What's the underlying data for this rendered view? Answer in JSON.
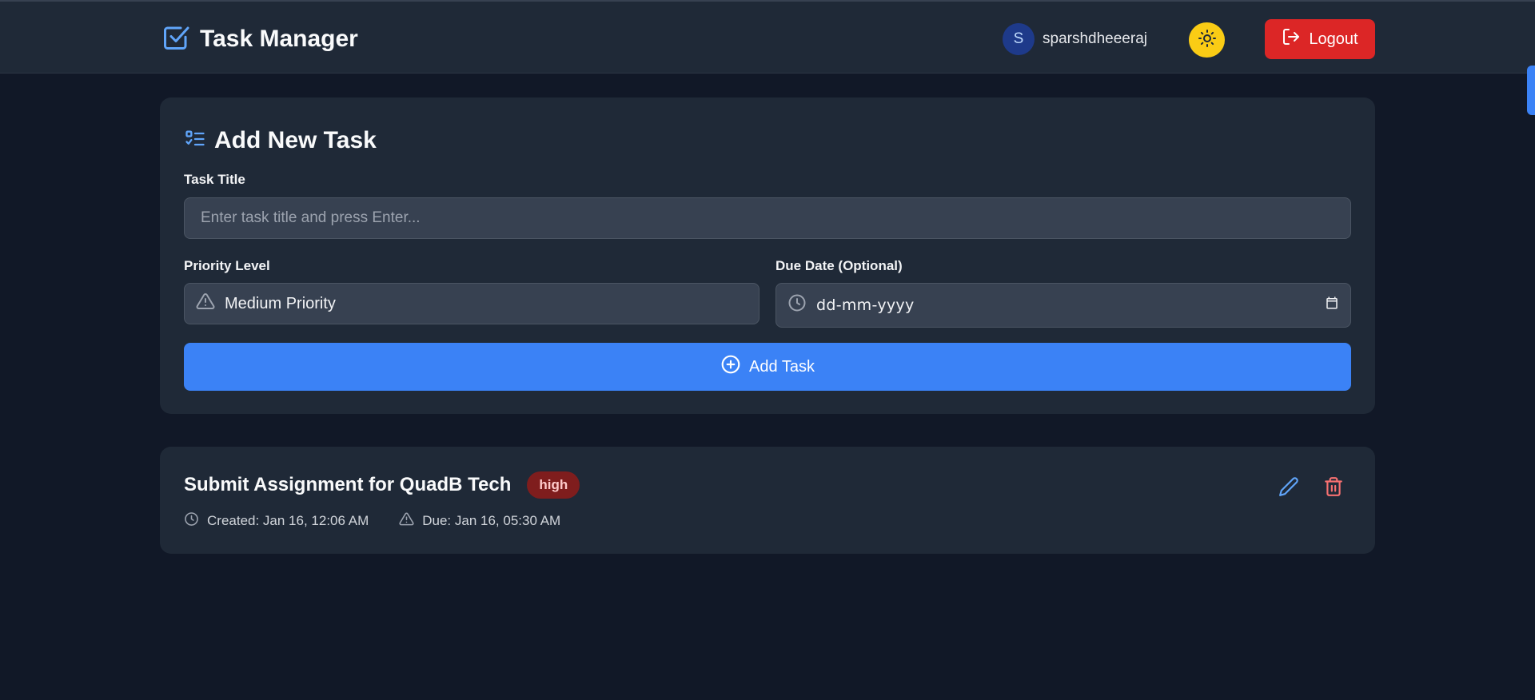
{
  "header": {
    "app_title": "Task Manager",
    "app_icon": "check-square-icon",
    "user": {
      "avatar_letter": "S",
      "name": "sparshdheeeraj"
    },
    "theme_toggle_icon": "sun-icon",
    "logout_label": "Logout",
    "logout_icon": "logout-icon"
  },
  "add_task": {
    "heading": "Add New Task",
    "heading_icon": "list-check-icon",
    "title_label": "Task Title",
    "title_placeholder": "Enter task title and press Enter...",
    "title_value": "",
    "priority_label": "Priority Level",
    "priority_value": "Medium Priority",
    "priority_icon": "warning-icon",
    "due_label": "Due Date (Optional)",
    "due_value": "dd-mm-yyyy",
    "due_icon": "clock-icon",
    "calendar_icon": "calendar-icon",
    "submit_label": "Add Task",
    "submit_icon": "plus-circle-icon"
  },
  "tasks": [
    {
      "title": "Submit Assignment for QuadB Tech",
      "priority": "high",
      "created": "Created: Jan 16, 12:06 AM",
      "due": "Due: Jan 16, 05:30 AM",
      "edit_icon": "pencil-icon",
      "delete_icon": "trash-icon"
    }
  ],
  "colors": {
    "background": "#111827",
    "surface": "#1f2937",
    "input": "#374151",
    "accent": "#3b82f6",
    "danger": "#dc2626",
    "theme_toggle": "#facc15",
    "badge_high": "#7f1d1d"
  }
}
